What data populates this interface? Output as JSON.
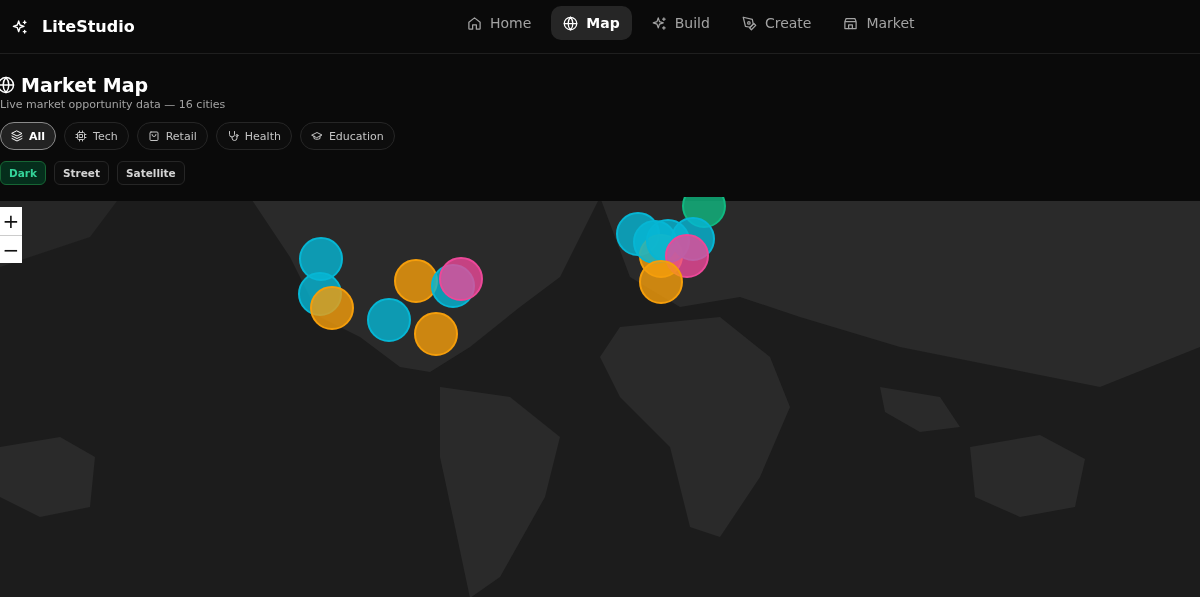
{
  "app": {
    "name": "LiteStudio"
  },
  "nav": [
    {
      "label": "Home",
      "selected": false
    },
    {
      "label": "Map",
      "selected": true
    },
    {
      "label": "Build",
      "selected": false
    },
    {
      "label": "Create",
      "selected": false
    },
    {
      "label": "Market",
      "selected": false
    }
  ],
  "page": {
    "title": "Market Map",
    "subtitle": "Live market opportunity data — 16 cities"
  },
  "categories": [
    {
      "label": "All",
      "selected": true
    },
    {
      "label": "Tech",
      "selected": false
    },
    {
      "label": "Retail",
      "selected": false
    },
    {
      "label": "Health",
      "selected": false
    },
    {
      "label": "Education",
      "selected": false
    }
  ],
  "map_styles": [
    {
      "label": "Dark",
      "selected": true
    },
    {
      "label": "Street",
      "selected": false
    },
    {
      "label": "Satellite",
      "selected": false
    }
  ],
  "zoom": {
    "in": "+",
    "out": "−"
  },
  "markers": [
    {
      "color": "#06b6d4"
    },
    {
      "color": "#06b6d4"
    },
    {
      "color": "#f59e0b"
    },
    {
      "color": "#06b6d4"
    },
    {
      "color": "#f59e0b"
    },
    {
      "color": "#f59e0b"
    },
    {
      "color": "#06b6d4"
    },
    {
      "color": "#ec4899"
    },
    {
      "color": "#06b6d4"
    },
    {
      "color": "#10b981"
    },
    {
      "color": "#f59e0b"
    },
    {
      "color": "#06b6d4"
    },
    {
      "color": "#06b6d4"
    },
    {
      "color": "#06b6d4"
    },
    {
      "color": "#ec4899"
    },
    {
      "color": "#f59e0b"
    }
  ]
}
